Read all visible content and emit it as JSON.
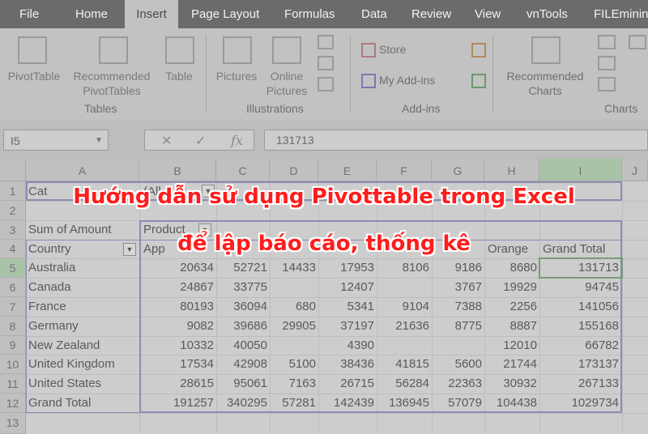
{
  "tabs": [
    "File",
    "Home",
    "Insert",
    "Page Layout",
    "Formulas",
    "Data",
    "Review",
    "View",
    "vnTools",
    "FILEmining"
  ],
  "active_tab": "Insert",
  "ribbon": {
    "pivottable": "PivotTable",
    "recommended_pivot": [
      "Recommended",
      "PivotTables"
    ],
    "table": "Table",
    "pictures": "Pictures",
    "online_pictures": [
      "Online",
      "Pictures"
    ],
    "store": "Store",
    "my_addins": "My Add-ins",
    "recommended_charts": [
      "Recommended",
      "Charts"
    ],
    "groups": {
      "tables": "Tables",
      "illustrations": "Illustrations",
      "addins": "Add-ins",
      "charts": "Charts"
    }
  },
  "formula_bar": {
    "name_box": "I5",
    "fx": "fx",
    "content": "131713"
  },
  "columns": [
    "A",
    "B",
    "C",
    "D",
    "E",
    "F",
    "G",
    "H",
    "I",
    "J"
  ],
  "rows": [
    "1",
    "2",
    "3",
    "4",
    "5",
    "6",
    "7",
    "8",
    "9",
    "10",
    "11",
    "12",
    "13"
  ],
  "cells": {
    "a1": "Cat",
    "b1": "(All",
    "a3": "Sum of Amount",
    "b3": "Product",
    "a4": "Country",
    "b4": "App",
    "h4": "Orange",
    "i4": "Grand Total"
  },
  "table_rows": [
    {
      "label": "Australia",
      "values": [
        "20634",
        "52721",
        "14433",
        "17953",
        "8106",
        "9186",
        "8680",
        "131713"
      ]
    },
    {
      "label": "Canada",
      "values": [
        "24867",
        "33775",
        "",
        "12407",
        "",
        "3767",
        "19929",
        "94745"
      ]
    },
    {
      "label": "France",
      "values": [
        "80193",
        "36094",
        "680",
        "5341",
        "9104",
        "7388",
        "2256",
        "141056"
      ]
    },
    {
      "label": "Germany",
      "values": [
        "9082",
        "39686",
        "29905",
        "37197",
        "21636",
        "8775",
        "8887",
        "155168"
      ]
    },
    {
      "label": "New Zealand",
      "values": [
        "10332",
        "40050",
        "",
        "4390",
        "",
        "",
        "12010",
        "66782"
      ]
    },
    {
      "label": "United Kingdom",
      "values": [
        "17534",
        "42908",
        "5100",
        "38436",
        "41815",
        "5600",
        "21744",
        "173137"
      ]
    },
    {
      "label": "United States",
      "values": [
        "28615",
        "95061",
        "7163",
        "26715",
        "56284",
        "22363",
        "30932",
        "267133"
      ]
    },
    {
      "label": "Grand Total",
      "values": [
        "191257",
        "340295",
        "57281",
        "142439",
        "136945",
        "57079",
        "104438",
        "1029734"
      ]
    }
  ],
  "overlay": {
    "line1": "Hướng dẫn sử dụng Pivottable trong Excel",
    "line2": "để lập báo cáo, thống kê"
  },
  "colors": {
    "overlay_text": "#ff1c1c",
    "tab_bar": "#6b6b6b",
    "ribbon": "#c2c2c2",
    "pivot_border": "#8c8cb4"
  }
}
